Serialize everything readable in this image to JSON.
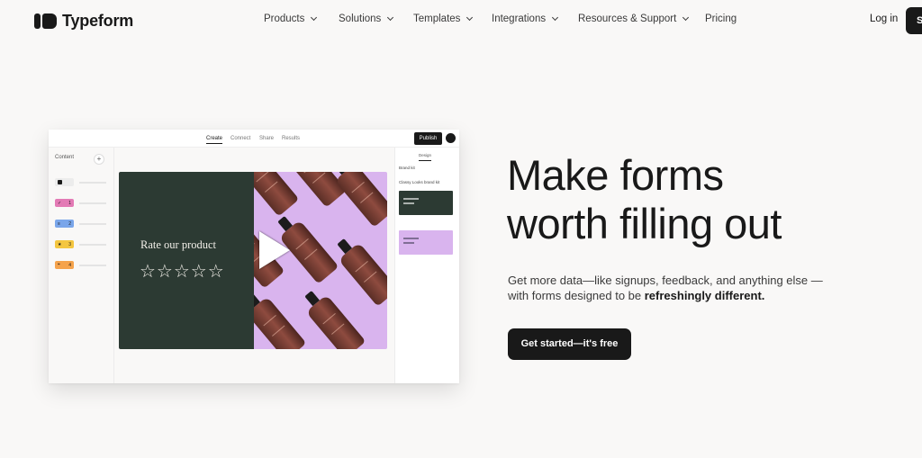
{
  "brand": {
    "name": "Typeform",
    "logo_icon": "typeform-logo-icon"
  },
  "nav": {
    "items": [
      {
        "label": "Products",
        "has_dropdown": true
      },
      {
        "label": "Solutions",
        "has_dropdown": true
      },
      {
        "label": "Templates",
        "has_dropdown": true
      },
      {
        "label": "Integrations",
        "has_dropdown": true
      },
      {
        "label": "Resources & Support",
        "has_dropdown": true
      },
      {
        "label": "Pricing",
        "has_dropdown": false
      }
    ],
    "login_label": "Log in",
    "signup_label": "S"
  },
  "mockup": {
    "tabs": [
      "Create",
      "Connect",
      "Share",
      "Results"
    ],
    "active_tab": "Create",
    "publish_label": "Publish",
    "sidebar_title": "Content",
    "sidebar_add": "+",
    "questions": [
      {
        "icon": "statement-icon",
        "number": "",
        "color": "#ececec"
      },
      {
        "icon": "check-icon",
        "number": "1",
        "color": "#e37ab5"
      },
      {
        "icon": "list-icon",
        "number": "2",
        "color": "#7aa6ea"
      },
      {
        "icon": "star-icon",
        "number": "3",
        "color": "#f4c640"
      },
      {
        "icon": "quote-icon",
        "number": "4",
        "color": "#f5a34c"
      }
    ],
    "card": {
      "question": "Rate our product",
      "stars": "☆☆☆☆☆",
      "left_color": "#2c3a33",
      "right_color": "#d9b4ee",
      "play_icon": "play-icon"
    },
    "panel": {
      "tab": "Design",
      "label1": "Brand kit",
      "label2": "Classy Looks brand kit",
      "themes": [
        {
          "color": "#2c3a33"
        },
        {
          "color": "#d9b4ee"
        }
      ]
    }
  },
  "hero": {
    "title_line1": "Make forms",
    "title_line2": "worth filling out",
    "subtitle_1": "Get more data—like signups, feedback, and anything else —with forms designed to be ",
    "subtitle_bold": "refreshingly different.",
    "cta_label": "Get started—it's free"
  },
  "colors": {
    "background": "#f9f8f7",
    "text": "#191919",
    "button": "#191919"
  }
}
